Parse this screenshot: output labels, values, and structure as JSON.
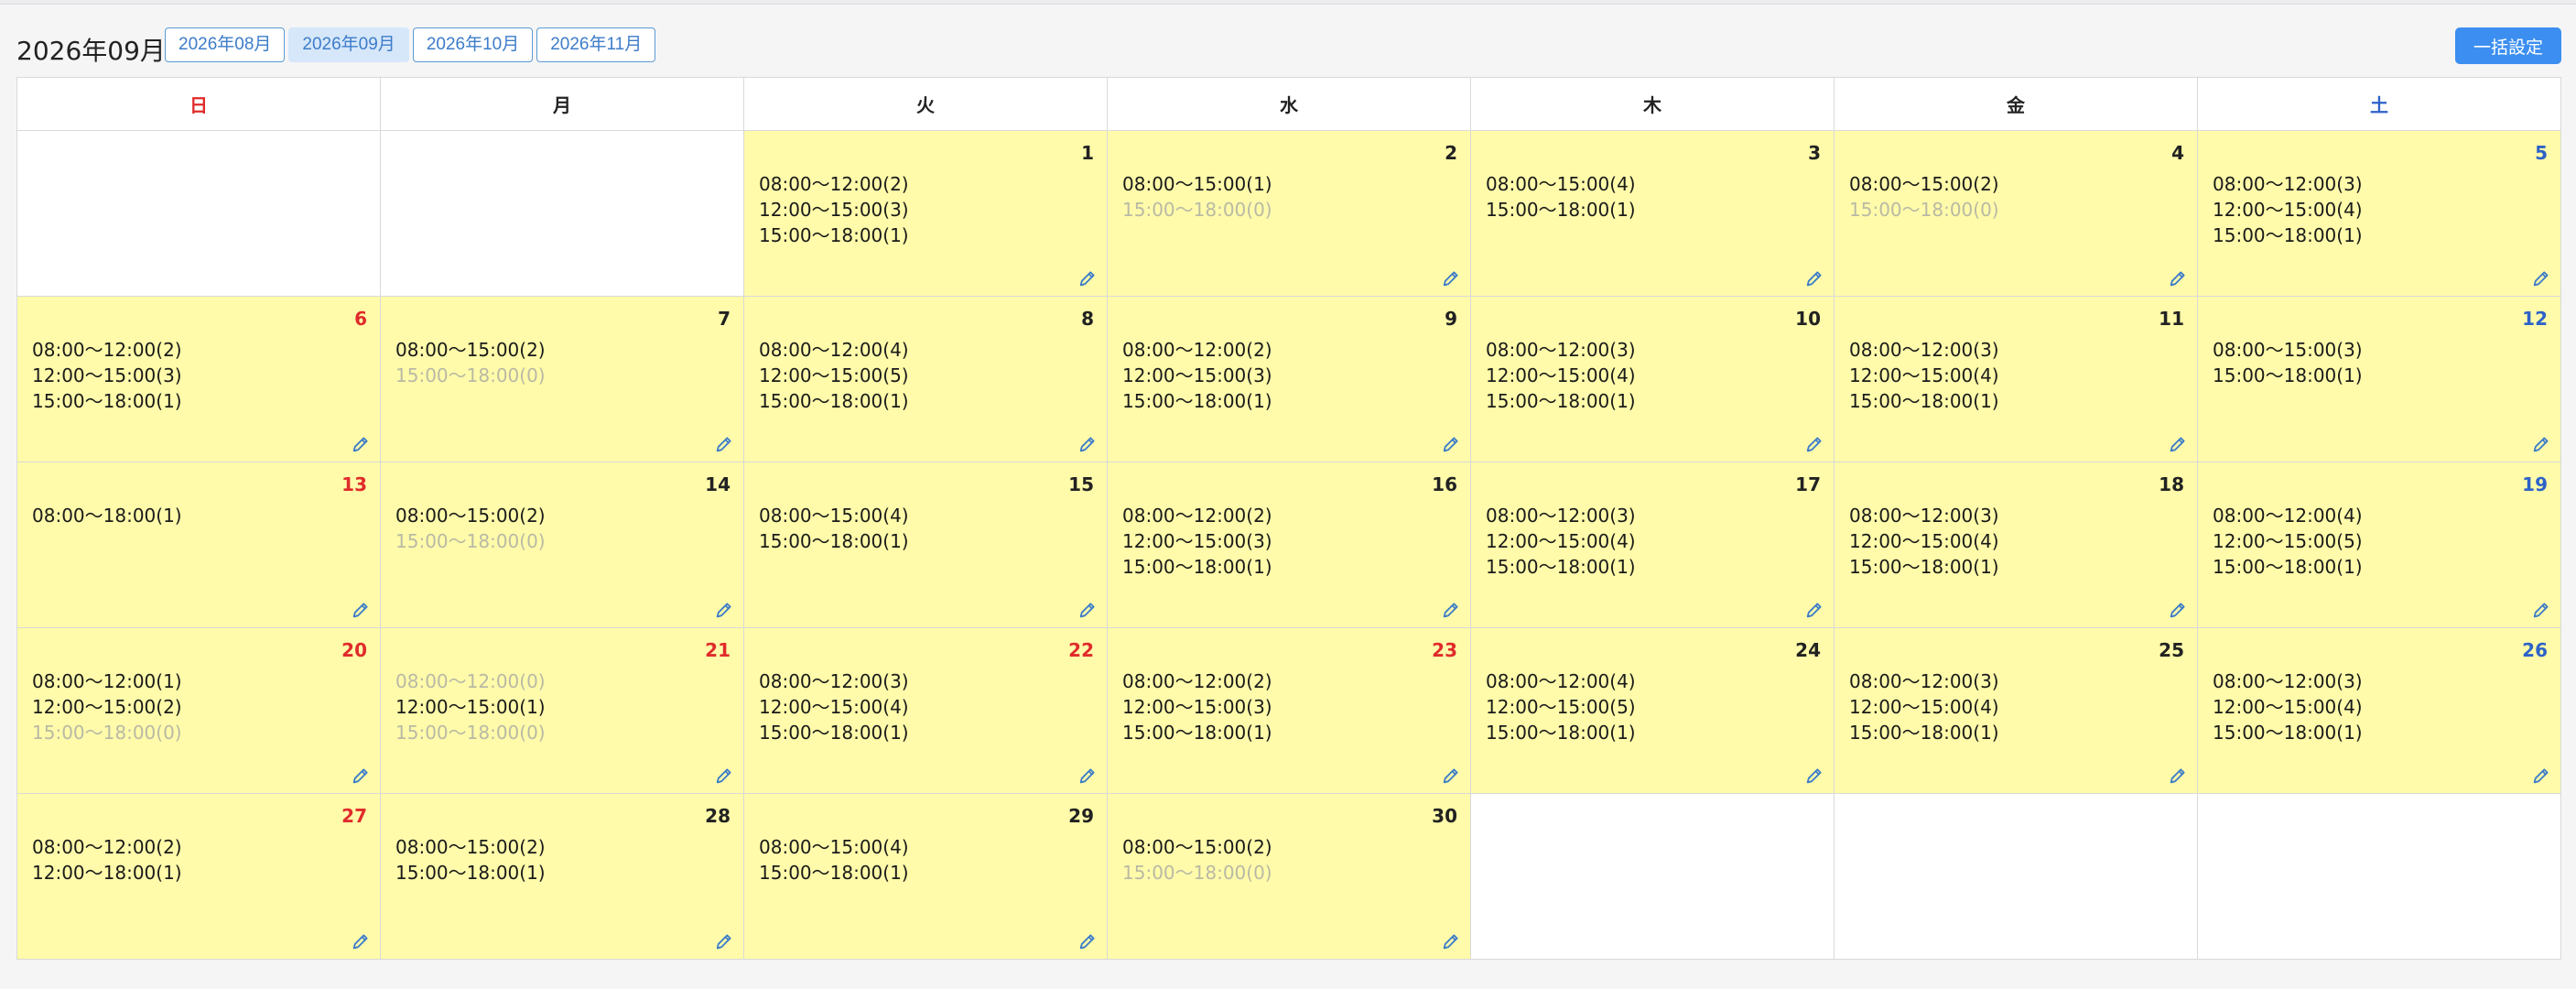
{
  "header": {
    "title": "2026年09月",
    "tabs": [
      {
        "label": "2026年08月",
        "active": false
      },
      {
        "label": "2026年09月",
        "active": true
      },
      {
        "label": "2026年10月",
        "active": false
      },
      {
        "label": "2026年11月",
        "active": false
      }
    ],
    "bulk_button": "一括設定"
  },
  "colors": {
    "accent": "#3c8ff0",
    "cell_fill": "#fffbaa",
    "sunday": "#e02b2b",
    "saturday": "#2d62c8",
    "unavailable_text": "#b9b9a5"
  },
  "weekdays": [
    {
      "label": "日",
      "kind": "sun"
    },
    {
      "label": "月",
      "kind": ""
    },
    {
      "label": "火",
      "kind": ""
    },
    {
      "label": "水",
      "kind": ""
    },
    {
      "label": "木",
      "kind": ""
    },
    {
      "label": "金",
      "kind": ""
    },
    {
      "label": "土",
      "kind": "sat"
    }
  ],
  "edit_icon": "pencil-icon",
  "weeks": [
    [
      null,
      null,
      {
        "day": "1",
        "color": "",
        "slots": [
          {
            "text": "08:00〜12:00(2)"
          },
          {
            "text": "12:00〜15:00(3)"
          },
          {
            "text": "15:00〜18:00(1)"
          }
        ]
      },
      {
        "day": "2",
        "color": "",
        "slots": [
          {
            "text": "08:00〜15:00(1)"
          },
          {
            "text": "15:00〜18:00(0)",
            "dim": true
          }
        ]
      },
      {
        "day": "3",
        "color": "",
        "slots": [
          {
            "text": "08:00〜15:00(4)"
          },
          {
            "text": "15:00〜18:00(1)"
          }
        ]
      },
      {
        "day": "4",
        "color": "",
        "slots": [
          {
            "text": "08:00〜15:00(2)"
          },
          {
            "text": "15:00〜18:00(0)",
            "dim": true
          }
        ]
      },
      {
        "day": "5",
        "color": "blue",
        "slots": [
          {
            "text": "08:00〜12:00(3)"
          },
          {
            "text": "12:00〜15:00(4)"
          },
          {
            "text": "15:00〜18:00(1)"
          }
        ]
      }
    ],
    [
      {
        "day": "6",
        "color": "red",
        "slots": [
          {
            "text": "08:00〜12:00(2)"
          },
          {
            "text": "12:00〜15:00(3)"
          },
          {
            "text": "15:00〜18:00(1)"
          }
        ]
      },
      {
        "day": "7",
        "color": "",
        "slots": [
          {
            "text": "08:00〜15:00(2)"
          },
          {
            "text": "15:00〜18:00(0)",
            "dim": true
          }
        ]
      },
      {
        "day": "8",
        "color": "",
        "slots": [
          {
            "text": "08:00〜12:00(4)"
          },
          {
            "text": "12:00〜15:00(5)"
          },
          {
            "text": "15:00〜18:00(1)"
          }
        ]
      },
      {
        "day": "9",
        "color": "",
        "slots": [
          {
            "text": "08:00〜12:00(2)"
          },
          {
            "text": "12:00〜15:00(3)"
          },
          {
            "text": "15:00〜18:00(1)"
          }
        ]
      },
      {
        "day": "10",
        "color": "",
        "slots": [
          {
            "text": "08:00〜12:00(3)"
          },
          {
            "text": "12:00〜15:00(4)"
          },
          {
            "text": "15:00〜18:00(1)"
          }
        ]
      },
      {
        "day": "11",
        "color": "",
        "slots": [
          {
            "text": "08:00〜12:00(3)"
          },
          {
            "text": "12:00〜15:00(4)"
          },
          {
            "text": "15:00〜18:00(1)"
          }
        ]
      },
      {
        "day": "12",
        "color": "blue",
        "slots": [
          {
            "text": "08:00〜15:00(3)"
          },
          {
            "text": "15:00〜18:00(1)"
          }
        ]
      }
    ],
    [
      {
        "day": "13",
        "color": "red",
        "slots": [
          {
            "text": "08:00〜18:00(1)"
          }
        ]
      },
      {
        "day": "14",
        "color": "",
        "slots": [
          {
            "text": "08:00〜15:00(2)"
          },
          {
            "text": "15:00〜18:00(0)",
            "dim": true
          }
        ]
      },
      {
        "day": "15",
        "color": "",
        "slots": [
          {
            "text": "08:00〜15:00(4)"
          },
          {
            "text": "15:00〜18:00(1)"
          }
        ]
      },
      {
        "day": "16",
        "color": "",
        "slots": [
          {
            "text": "08:00〜12:00(2)"
          },
          {
            "text": "12:00〜15:00(3)"
          },
          {
            "text": "15:00〜18:00(1)"
          }
        ]
      },
      {
        "day": "17",
        "color": "",
        "slots": [
          {
            "text": "08:00〜12:00(3)"
          },
          {
            "text": "12:00〜15:00(4)"
          },
          {
            "text": "15:00〜18:00(1)"
          }
        ]
      },
      {
        "day": "18",
        "color": "",
        "slots": [
          {
            "text": "08:00〜12:00(3)"
          },
          {
            "text": "12:00〜15:00(4)"
          },
          {
            "text": "15:00〜18:00(1)"
          }
        ]
      },
      {
        "day": "19",
        "color": "blue",
        "slots": [
          {
            "text": "08:00〜12:00(4)"
          },
          {
            "text": "12:00〜15:00(5)"
          },
          {
            "text": "15:00〜18:00(1)"
          }
        ]
      }
    ],
    [
      {
        "day": "20",
        "color": "red",
        "slots": [
          {
            "text": "08:00〜12:00(1)"
          },
          {
            "text": "12:00〜15:00(2)"
          },
          {
            "text": "15:00〜18:00(0)",
            "dim": true
          }
        ]
      },
      {
        "day": "21",
        "color": "red",
        "slots": [
          {
            "text": "08:00〜12:00(0)",
            "dim": true
          },
          {
            "text": "12:00〜15:00(1)"
          },
          {
            "text": "15:00〜18:00(0)",
            "dim": true
          }
        ]
      },
      {
        "day": "22",
        "color": "red",
        "slots": [
          {
            "text": "08:00〜12:00(3)"
          },
          {
            "text": "12:00〜15:00(4)"
          },
          {
            "text": "15:00〜18:00(1)"
          }
        ]
      },
      {
        "day": "23",
        "color": "red",
        "slots": [
          {
            "text": "08:00〜12:00(2)"
          },
          {
            "text": "12:00〜15:00(3)"
          },
          {
            "text": "15:00〜18:00(1)"
          }
        ]
      },
      {
        "day": "24",
        "color": "",
        "slots": [
          {
            "text": "08:00〜12:00(4)"
          },
          {
            "text": "12:00〜15:00(5)"
          },
          {
            "text": "15:00〜18:00(1)"
          }
        ]
      },
      {
        "day": "25",
        "color": "",
        "slots": [
          {
            "text": "08:00〜12:00(3)"
          },
          {
            "text": "12:00〜15:00(4)"
          },
          {
            "text": "15:00〜18:00(1)"
          }
        ]
      },
      {
        "day": "26",
        "color": "blue",
        "slots": [
          {
            "text": "08:00〜12:00(3)"
          },
          {
            "text": "12:00〜15:00(4)"
          },
          {
            "text": "15:00〜18:00(1)"
          }
        ]
      }
    ],
    [
      {
        "day": "27",
        "color": "red",
        "slots": [
          {
            "text": "08:00〜12:00(2)"
          },
          {
            "text": "12:00〜18:00(1)"
          }
        ]
      },
      {
        "day": "28",
        "color": "",
        "slots": [
          {
            "text": "08:00〜15:00(2)"
          },
          {
            "text": "15:00〜18:00(1)"
          }
        ]
      },
      {
        "day": "29",
        "color": "",
        "slots": [
          {
            "text": "08:00〜15:00(4)"
          },
          {
            "text": "15:00〜18:00(1)"
          }
        ]
      },
      {
        "day": "30",
        "color": "",
        "slots": [
          {
            "text": "08:00〜15:00(2)"
          },
          {
            "text": "15:00〜18:00(0)",
            "dim": true
          }
        ]
      },
      null,
      null,
      null
    ]
  ]
}
